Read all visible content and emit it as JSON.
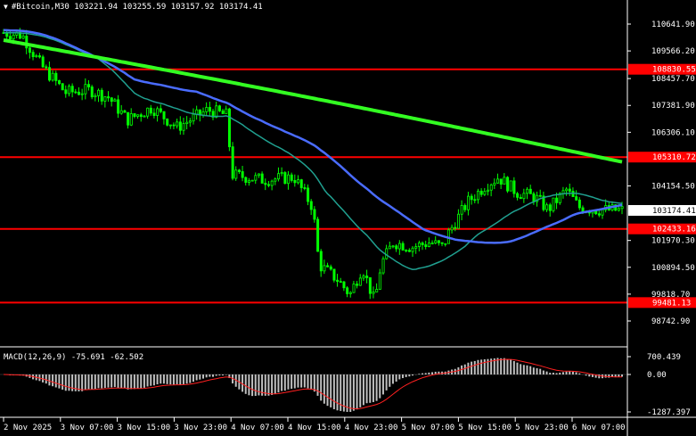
{
  "header": {
    "symbol": "#Bitcoin,M30",
    "open": "103221.94",
    "high": "103255.59",
    "low": "103157.92",
    "close": "103174.41"
  },
  "price_axis": {
    "ticks": [
      "110641.90",
      "109566.20",
      "108457.70",
      "107381.90",
      "106306.10",
      "104154.50",
      "101970.30",
      "100894.50",
      "99818.70",
      "98742.90"
    ],
    "current_price": "103174.41",
    "level_labels": [
      "108830.55",
      "105310.72",
      "102433.16",
      "99481.13"
    ]
  },
  "macd": {
    "title": "MACD(12,26,9) -75.691 -62.502",
    "ticks": [
      "700.439",
      "0.00",
      "-1287.397"
    ]
  },
  "time_axis": {
    "labels": [
      "2 Nov 2025",
      "3 Nov 07:00",
      "3 Nov 15:00",
      "3 Nov 23:00",
      "4 Nov 07:00",
      "4 Nov 15:00",
      "4 Nov 23:00",
      "5 Nov 07:00",
      "5 Nov 15:00",
      "5 Nov 23:00",
      "6 Nov 07:00"
    ]
  },
  "colors": {
    "background": "#000000",
    "candles": "#00ff00",
    "level_line": "#ff0000",
    "ma_fast": "#20a090",
    "ma_mid": "#4a6cff",
    "ma_slow": "#33ff22",
    "macd_hist": "#c0c0c0",
    "macd_signal": "#ff2020"
  }
}
